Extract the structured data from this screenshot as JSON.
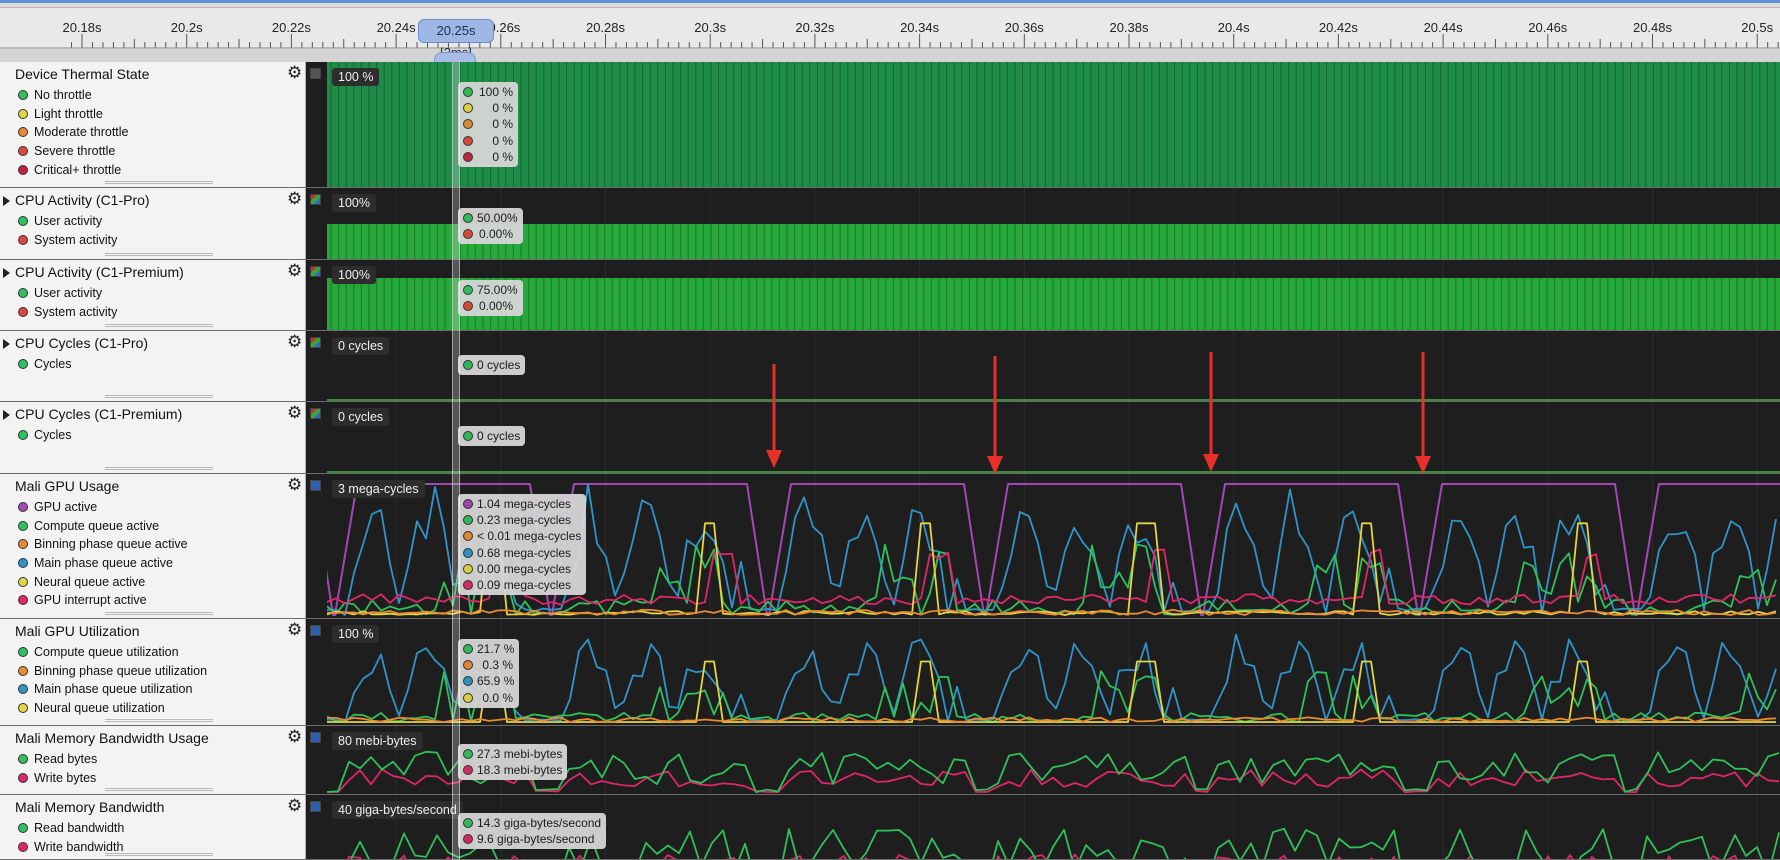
{
  "ruler": {
    "ticks": [
      "20.18s",
      "20.2s",
      "20.22s",
      "20.24s",
      "20.26s",
      "20.28s",
      "20.3s",
      "20.32s",
      "20.34s",
      "20.36s",
      "20.38s",
      "20.4s",
      "20.42s",
      "20.44s",
      "20.46s",
      "20.48s",
      "20.5s"
    ],
    "cursor_label": "20.25s [2ms]"
  },
  "colors": {
    "green": "#2fc15a",
    "yellow": "#e5d540",
    "orange": "#ea8a33",
    "red": "#e0473a",
    "crimson": "#c5213f",
    "purple": "#a348b5",
    "blue": "#2f95c8",
    "pink": "#e0266a",
    "thermal_fill": "#1f8c48",
    "cpu_fill": "#27a83a",
    "cycles_line": "#3c8a3c",
    "arrow": "#e8302b"
  },
  "tracks": [
    {
      "id": "thermal",
      "title": "Device Thermal State",
      "expandable": false,
      "swatch": "#555555",
      "scale": "100 %",
      "series": [
        {
          "label": "No throttle",
          "color": "#2fc15a",
          "value": "100 %"
        },
        {
          "label": "Light throttle",
          "color": "#e5d540",
          "value": "0 %"
        },
        {
          "label": "Moderate throttle",
          "color": "#ea8a33",
          "value": "0 %"
        },
        {
          "label": "Severe throttle",
          "color": "#e0473a",
          "value": "0 %"
        },
        {
          "label": "Critical+ throttle",
          "color": "#c5213f",
          "value": "0 %"
        }
      ]
    },
    {
      "id": "cpu-pro",
      "title": "CPU Activity (C1-Pro)",
      "expandable": true,
      "swatch": "multi",
      "scale": "100%",
      "series": [
        {
          "label": "User activity",
          "color": "#2fc15a",
          "value": "50.00%"
        },
        {
          "label": "System activity",
          "color": "#e0473a",
          "value": "0.00%"
        }
      ]
    },
    {
      "id": "cpu-premium",
      "title": "CPU Activity (C1-Premium)",
      "expandable": true,
      "swatch": "multi",
      "scale": "100%",
      "series": [
        {
          "label": "User activity",
          "color": "#2fc15a",
          "value": "75.00%"
        },
        {
          "label": "System activity",
          "color": "#e0473a",
          "value": "0.00%"
        }
      ]
    },
    {
      "id": "cycles-pro",
      "title": "CPU Cycles (C1-Pro)",
      "expandable": true,
      "swatch": "multi",
      "scale": "0 cycles",
      "series": [
        {
          "label": "Cycles",
          "color": "#2fc15a",
          "value": "0 cycles"
        }
      ]
    },
    {
      "id": "cycles-premium",
      "title": "CPU Cycles (C1-Premium)",
      "expandable": true,
      "swatch": "multi",
      "scale": "0 cycles",
      "series": [
        {
          "label": "Cycles",
          "color": "#2fc15a",
          "value": "0 cycles"
        }
      ]
    },
    {
      "id": "gpu-usage",
      "title": "Mali GPU Usage",
      "expandable": false,
      "swatch": "#2f5fb0",
      "scale": "3 mega-cycles",
      "series": [
        {
          "label": "GPU active",
          "color": "#a348b5",
          "value": "1.04 mega-cycles"
        },
        {
          "label": "Compute queue active",
          "color": "#2fc15a",
          "value": "0.23 mega-cycles"
        },
        {
          "label": "Binning phase queue active",
          "color": "#ea8a33",
          "value": "< 0.01 mega-cycles"
        },
        {
          "label": "Main phase queue active",
          "color": "#2f95c8",
          "value": "0.68 mega-cycles"
        },
        {
          "label": "Neural queue active",
          "color": "#e5d540",
          "value": "0.00 mega-cycles"
        },
        {
          "label": "GPU interrupt active",
          "color": "#e0266a",
          "value": "0.09 mega-cycles"
        }
      ]
    },
    {
      "id": "gpu-util",
      "title": "Mali GPU Utilization",
      "expandable": false,
      "swatch": "#2f5fb0",
      "scale": "100 %",
      "series": [
        {
          "label": "Compute queue utilization",
          "color": "#2fc15a",
          "value": "21.7 %"
        },
        {
          "label": "Binning phase queue utilization",
          "color": "#ea8a33",
          "value": "0.3 %"
        },
        {
          "label": "Main phase queue utilization",
          "color": "#2f95c8",
          "value": "65.9 %"
        },
        {
          "label": "Neural queue utilization",
          "color": "#e5d540",
          "value": "0.0 %"
        }
      ]
    },
    {
      "id": "mem-usage",
      "title": "Mali Memory Bandwidth Usage",
      "expandable": false,
      "swatch": "#2f5fb0",
      "scale": "80 mebi-bytes",
      "series": [
        {
          "label": "Read bytes",
          "color": "#2fc15a",
          "value": "27.3 mebi-bytes"
        },
        {
          "label": "Write bytes",
          "color": "#e0266a",
          "value": "18.3 mebi-bytes"
        }
      ]
    },
    {
      "id": "mem-bw",
      "title": "Mali Memory Bandwidth",
      "expandable": false,
      "swatch": "#2f5fb0",
      "scale": "40 giga-bytes/second",
      "series": [
        {
          "label": "Read bandwidth",
          "color": "#2fc15a",
          "value": "14.3 giga-bytes/second"
        },
        {
          "label": "Write bandwidth",
          "color": "#e0266a",
          "value": "9.6 giga-bytes/second"
        }
      ]
    }
  ]
}
